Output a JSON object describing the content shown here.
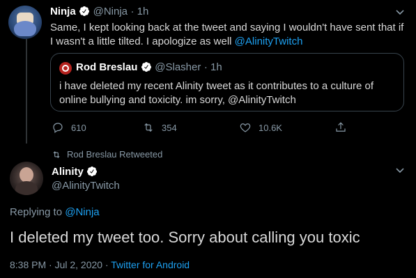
{
  "colors": {
    "background": "#000000",
    "text": "#d9d9d9",
    "muted": "#8899a6",
    "link": "#1da1f2",
    "verified": "#ffffff",
    "border": "#38444d"
  },
  "tweet1": {
    "name": "Ninja",
    "handle": "@Ninja",
    "time": "· 1h",
    "text_line1": "Same, I kept looking back at the tweet and saying I wouldn't have sent that if",
    "text_line2": "I wasn't a little tilted. I apologize as well ",
    "mention": "@AlinityTwitch",
    "quote": {
      "name": "Rod Breslau",
      "handle": "@Slasher",
      "time": "· 1h",
      "text_line1": "i have deleted my recent Alinity tweet as it contributes to a culture of",
      "text_line2": "online bullying and toxicity. im sorry, @AlinityTwitch"
    },
    "actions": {
      "replies": "610",
      "retweets": "354",
      "likes": "10.6K"
    }
  },
  "retweet_notice": "Rod Breslau Retweeted",
  "tweet2": {
    "name": "Alinity",
    "handle": "@AlinityTwitch",
    "replying_prefix": "Replying to ",
    "replying_to": "@Ninja",
    "text": "I deleted my tweet too. Sorry about calling you toxic",
    "timestamp": "8:38 PM · Jul 2, 2020 · ",
    "source": "Twitter for Android"
  },
  "icons": [
    "verified-icon",
    "reply-icon",
    "retweet-icon",
    "like-icon",
    "share-icon",
    "chevron-down-icon",
    "slasher-logo-icon"
  ]
}
